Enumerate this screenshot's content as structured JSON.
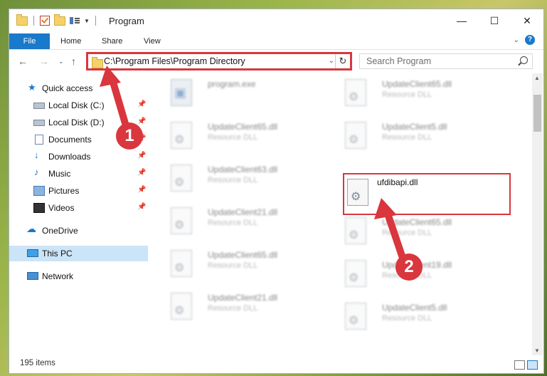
{
  "window": {
    "title": "Program"
  },
  "ribbon": {
    "tabs": [
      "File",
      "Home",
      "Share",
      "View"
    ]
  },
  "address": {
    "path": "C:\\Program Files\\Program Directory"
  },
  "search": {
    "placeholder": "Search Program"
  },
  "sidebar": {
    "items": [
      {
        "label": "Quick access",
        "icon": "star-icon"
      },
      {
        "label": "Local Disk (C:)",
        "icon": "disk-icon"
      },
      {
        "label": "Local Disk (D:)",
        "icon": "disk-icon"
      },
      {
        "label": "Documents",
        "icon": "documents-icon"
      },
      {
        "label": "Downloads",
        "icon": "downloads-icon"
      },
      {
        "label": "Music",
        "icon": "music-icon"
      },
      {
        "label": "Pictures",
        "icon": "pictures-icon"
      },
      {
        "label": "Videos",
        "icon": "videos-icon"
      },
      {
        "label": "OneDrive",
        "icon": "onedrive-icon"
      },
      {
        "label": "This PC",
        "icon": "pc-icon"
      },
      {
        "label": "Network",
        "icon": "network-icon"
      }
    ]
  },
  "files": [
    {
      "name": "program.exe",
      "type": ""
    },
    {
      "name": "UpdateClient65.dll",
      "type": "Resource DLL"
    },
    {
      "name": "UpdateClient65.dll",
      "type": "Resource DLL"
    },
    {
      "name": "UpdateClient5.dll",
      "type": "Resource DLL"
    },
    {
      "name": "UpdateClient63.dll",
      "type": "Resource DLL"
    },
    {
      "name": "ufdibapi.dll",
      "type": ""
    },
    {
      "name": "UpdateClient21.dll",
      "type": "Resource DLL"
    },
    {
      "name": "UpdateClient65.dll",
      "type": "Resource DLL"
    },
    {
      "name": "UpdateClient65.dll",
      "type": "Resource DLL"
    },
    {
      "name": "UpdateClient19.dll",
      "type": "Resource DLL"
    },
    {
      "name": "UpdateClient21.dll",
      "type": "Resource DLL"
    },
    {
      "name": "UpdateClient5.dll",
      "type": "Resource DLL"
    }
  ],
  "status": {
    "count": "195 items"
  },
  "callouts": [
    "1",
    "2"
  ],
  "colors": {
    "accent": "#1979ca",
    "highlight": "#d9363e"
  }
}
